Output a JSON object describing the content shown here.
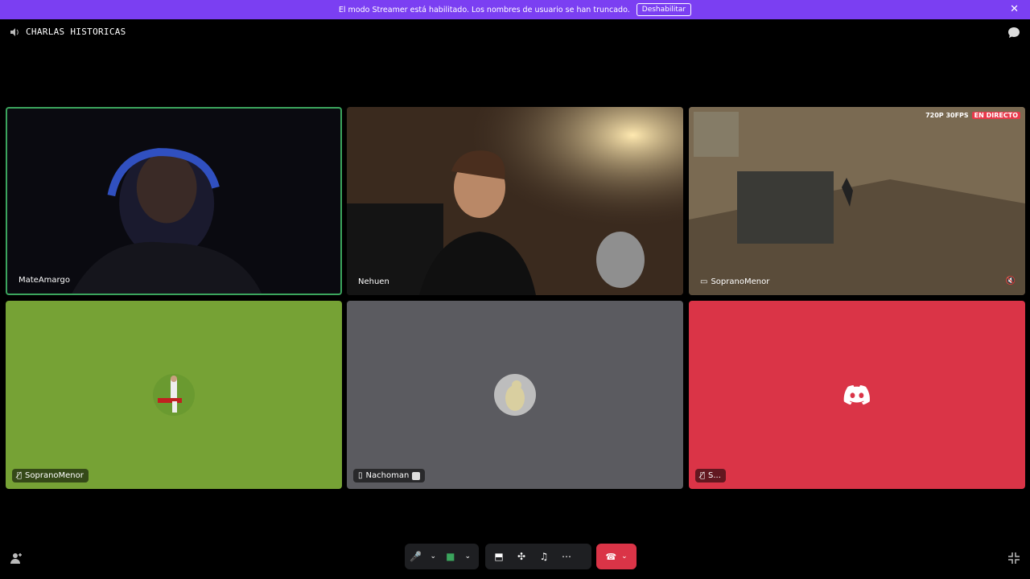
{
  "banner": {
    "text": "El modo Streamer está habilitado. Los nombres de usuario se han truncado.",
    "button": "Deshabilitar"
  },
  "channel": {
    "name": "CHARLAS HISTORICAS"
  },
  "tiles": [
    {
      "name": "MateAmargo"
    },
    {
      "name": "Nehuen"
    },
    {
      "name": "SopranoMenor",
      "quality": "720P 30FPS",
      "live": "EN DIRECTO"
    },
    {
      "name": "SopranoMenor"
    },
    {
      "name": "Nachoman"
    },
    {
      "name": "S..."
    }
  ],
  "colors": {
    "accent": "#7b3ff2",
    "speaking": "#3ba55d",
    "danger": "#da3447",
    "tile_green": "#76a235",
    "tile_gray": "#5b5b60"
  }
}
